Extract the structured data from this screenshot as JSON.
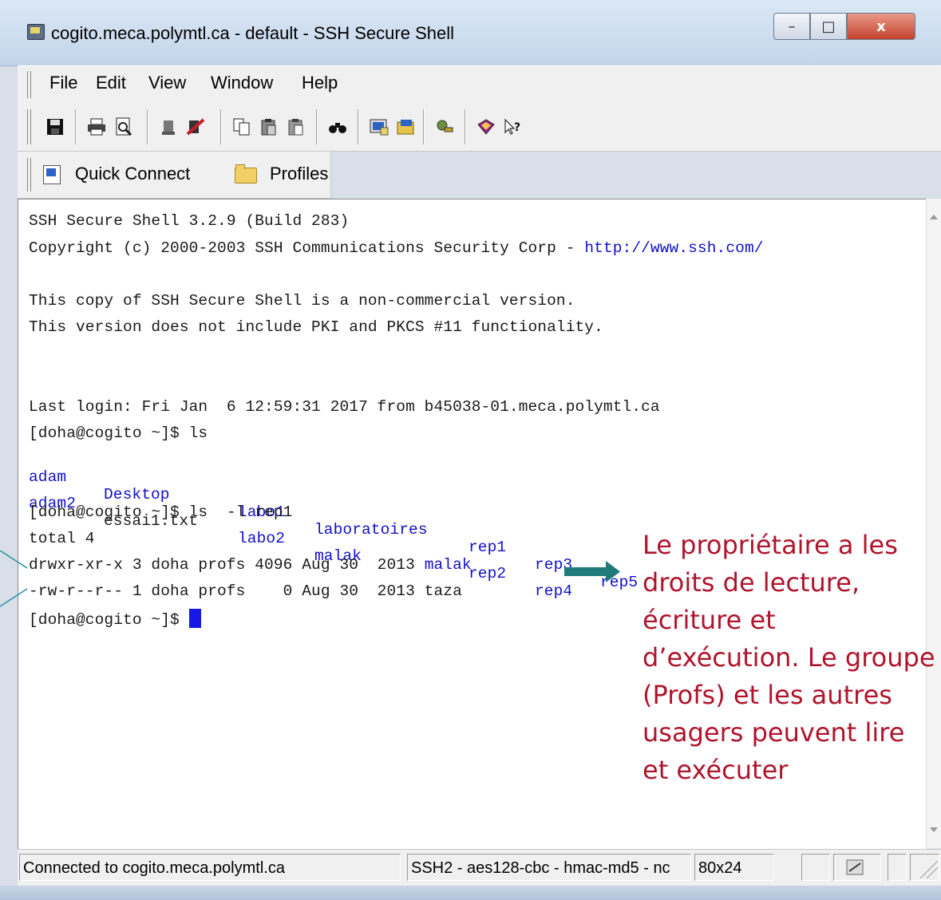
{
  "window": {
    "title": "cogito.meca.polymtl.ca - default - SSH Secure Shell",
    "buttons": {
      "min": "–",
      "max": "□",
      "close": "x"
    }
  },
  "menu": [
    "File",
    "Edit",
    "View",
    "Window",
    "Help"
  ],
  "toolbar_icons": [
    "save-icon",
    "print-icon",
    "print-preview-icon",
    "disconnect-icon",
    "settings-icon",
    "copy-icon",
    "paste-icon",
    "paste-special-icon",
    "find-icon",
    "new-terminal-icon",
    "new-file-transfer-icon",
    "key-icon",
    "help-book-icon",
    "context-help-icon"
  ],
  "quickbar": {
    "quick_connect": "Quick Connect",
    "profiles": "Profiles"
  },
  "terminal": {
    "lines": [
      "SSH Secure Shell 3.2.9 (Build 283)",
      "Copyright (c) 2000-2003 SSH Communications Security Corp - http://www.ssh.com/",
      "",
      "This copy of SSH Secure Shell is a non-commercial version.",
      "This version does not include PKI and PKCS #11 functionality.",
      "",
      "",
      "Last login: Fri Jan  6 12:59:31 2017 from b45038-01.meca.polymtl.ca",
      "[doha@cogito ~]$ ls",
      "adam   Desktop    labo1  laboratoires  rep1  rep3  rep5",
      "adam2  essai1.txt  labo2  malak        rep2  rep4",
      "[doha@cogito ~]$ ls  -l rep1",
      "total 4",
      "drwxr-xr-x 3 doha profs 4096 Aug 30  2013 malak",
      "-rw-r--r-- 1 doha profs    0 Aug 30  2013 taza",
      "[doha@cogito ~]$ "
    ],
    "copyright_prefix": "Copyright (c) 2000-2003 SSH Communications Security Corp - ",
    "url": "http://www.ssh.com/",
    "ls_row1": [
      "adam",
      "Desktop",
      "labo1",
      "laboratoires",
      "rep1",
      "rep3",
      "rep5"
    ],
    "ls_row2": [
      "adam2",
      "essai1.txt",
      "labo2",
      "malak",
      "rep2",
      "rep4"
    ],
    "perm_line_prefix": "drwxr-xr-x 3 doha profs 4096 Aug 30  2013 ",
    "perm_line_name": "malak"
  },
  "status": {
    "connection": "Connected to cogito.meca.polymtl.ca",
    "cipher": "SSH2 - aes128-cbc - hmac-md5 - nc",
    "size": "80x24"
  },
  "annotation": {
    "text": "Le propriétaire a les droits de lecture, écriture et d’exécution. Le groupe (Profs) et les autres usagers peuvent lire et exécuter"
  },
  "colors": {
    "annotation": "#b0142c",
    "terminal_blue": "#1010c8",
    "cursor": "#1818e6"
  }
}
